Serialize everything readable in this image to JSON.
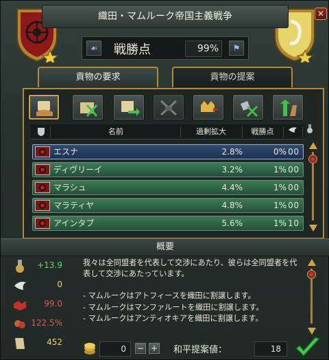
{
  "window": {
    "title": "織田・マムルーク帝国主義戦争",
    "close_glyph": "✕"
  },
  "score": {
    "label": "戦勝点",
    "value": "99%"
  },
  "tabs": [
    {
      "label": "貢物の要求",
      "active": true
    },
    {
      "label": "貢物の提案",
      "active": false
    }
  ],
  "demand_buttons": [
    {
      "icon": "scroll-hand-icon",
      "selected": true
    },
    {
      "icon": "map-cancel-icon",
      "selected": false
    },
    {
      "icon": "scroll-transfer-icon",
      "selected": false
    },
    {
      "icon": "crossed-swords-icon",
      "selected": false
    },
    {
      "icon": "crown-flag-icon",
      "selected": false
    },
    {
      "icon": "treaty-cancel-icon",
      "selected": false
    },
    {
      "icon": "arms-raise-icon",
      "selected": false
    }
  ],
  "table": {
    "headers": {
      "name": "名前",
      "ae": "過剰拡大",
      "ws": "戦勝点"
    },
    "rows": [
      {
        "name": "エスナ",
        "ae": "2.8%",
        "ws": "0%",
        "a": "0",
        "b": "0",
        "selected": true
      },
      {
        "name": "ディヴリーイ",
        "ae": "3.2%",
        "ws": "1%",
        "a": "0",
        "b": "0",
        "selected": false
      },
      {
        "name": "マラシュ",
        "ae": "4.4%",
        "ws": "1%",
        "a": "0",
        "b": "0",
        "selected": false
      },
      {
        "name": "マラティヤ",
        "ae": "4.8%",
        "ws": "1%",
        "a": "0",
        "b": "0",
        "selected": false
      },
      {
        "name": "アインタブ",
        "ae": "5.6%",
        "ws": "1%",
        "a": "0",
        "b": "1",
        "selected": false
      }
    ]
  },
  "summary": {
    "heading": "概要",
    "stats": [
      {
        "icon": "medal-icon",
        "value": "+13.9",
        "color": "#6fd07a"
      },
      {
        "icon": "dove-icon",
        "value": "0",
        "color": "#e7d36a"
      },
      {
        "icon": "handshake-red-icon",
        "value": "99.0",
        "color": "#e35a4a"
      },
      {
        "icon": "angry-crowd-icon",
        "value": "122.5%",
        "color": "#e35a4a"
      },
      {
        "icon": "scroll-icon",
        "value": "452",
        "color": "#e7d36a"
      }
    ],
    "lines": [
      "我々は全同盟者を代表して交渉にあたり、彼らは全同盟者を代表して交渉にあたっています。",
      "",
      "- マムルークはアトフィースを織田に割譲します。",
      "- マムルークはマンファルートを織田に割譲します。",
      "- マムルークはアンティオキアを織田に割譲します。"
    ]
  },
  "gold": {
    "value": "0",
    "minus": "−",
    "plus": "+"
  },
  "peace": {
    "label": "和平提案値：",
    "value": "18"
  },
  "colors": {
    "gold": "#b48a3a",
    "selected_row": "#2f4a70",
    "row": "#3d7a54"
  }
}
